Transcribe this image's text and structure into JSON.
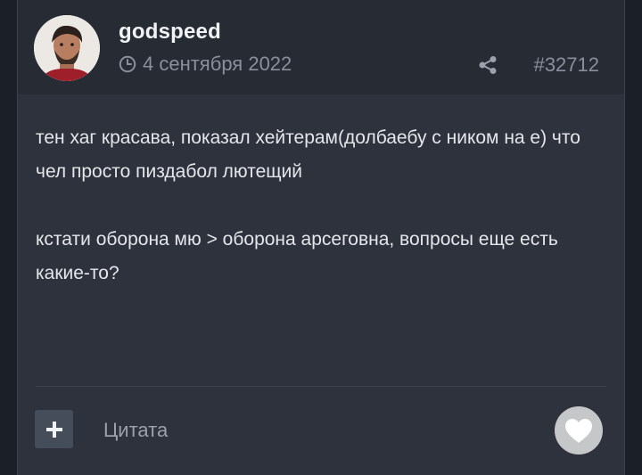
{
  "post": {
    "author": "godspeed",
    "date": "4 сентября 2022",
    "id": "#32712",
    "paragraphs": [
      "тен хаг красава, показал хейтерам(долбаебу с ником на е) что чел просто пиздабол лютещий",
      "кстати оборона мю > оборона арсеговна, вопросы еще есть какие-то?"
    ],
    "icons": {
      "date": "clock-icon",
      "share": "share-icon",
      "add": "plus-icon",
      "like": "heart-icon"
    }
  },
  "footer": {
    "quote_label": "Цитата"
  },
  "colors": {
    "background": "#2d323d",
    "header": "#262b34",
    "text": "#e4e6ea",
    "muted": "#8a909b",
    "button": "#454c5a",
    "like_bg": "#c6c7c9"
  }
}
